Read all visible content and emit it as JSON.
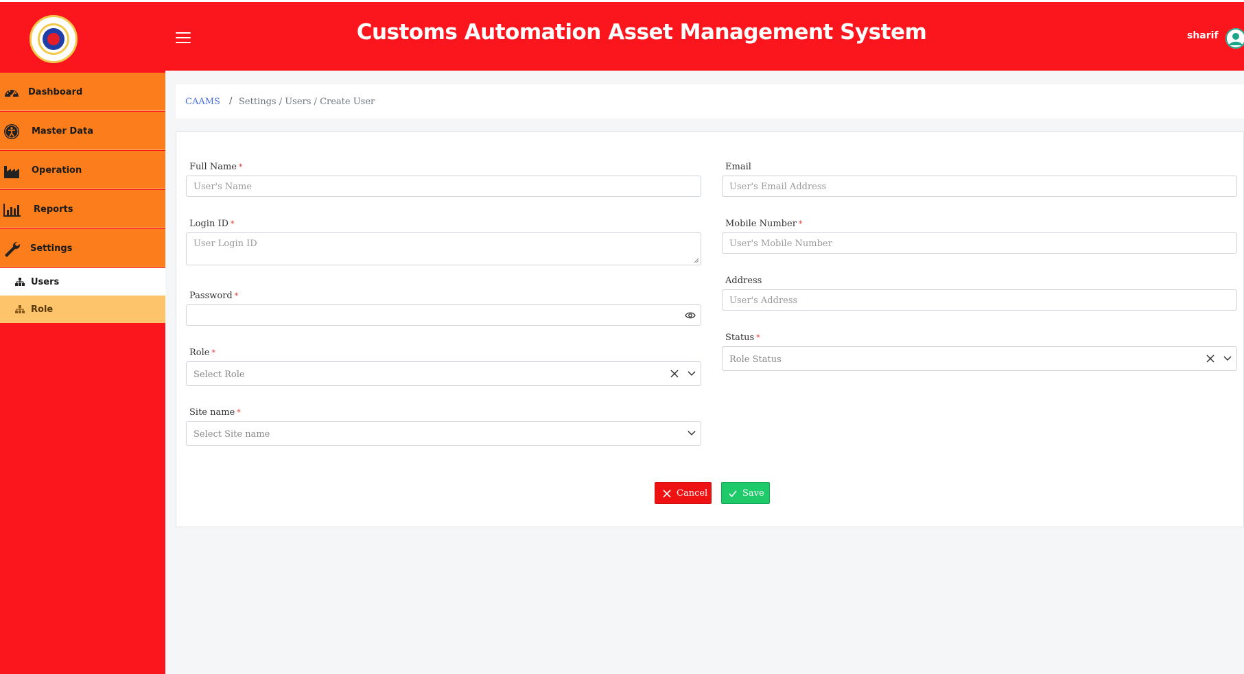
{
  "header": {
    "title": "Customs Automation Asset Management System",
    "username": "sharif",
    "logo_icon": "customs-emblem-logo",
    "menu_icon": "hamburger-menu-icon",
    "avatar_icon": "user-avatar-icon"
  },
  "sidebar": {
    "items": [
      {
        "label": "Dashboard",
        "icon": "dashboard-gauge-icon"
      },
      {
        "label": "Master Data",
        "icon": "accessibility-icon"
      },
      {
        "label": "Operation",
        "icon": "factory-icon"
      },
      {
        "label": "Reports",
        "icon": "bar-chart-icon"
      },
      {
        "label": "Settings",
        "icon": "wrench-icon"
      }
    ],
    "sub_items": [
      {
        "label": "Users",
        "icon": "sitemap-icon",
        "active": true
      },
      {
        "label": "Role",
        "icon": "sitemap-icon",
        "active": false
      }
    ]
  },
  "breadcrumb": {
    "home": "CAAMS",
    "separator": "/",
    "rest": "Settings / Users / Create User"
  },
  "form": {
    "full_name": {
      "label": "Full Name",
      "placeholder": "User's Name",
      "required": "*"
    },
    "email": {
      "label": "Email",
      "placeholder": "User's Email Address"
    },
    "login_id": {
      "label": "Login ID",
      "placeholder": "User Login ID",
      "required": "*"
    },
    "mobile": {
      "label": "Mobile Number",
      "placeholder": "User's Mobile Number",
      "required": "*"
    },
    "address": {
      "label": "Address",
      "placeholder": "User's Address"
    },
    "password": {
      "label": "Password",
      "placeholder": "",
      "required": "*"
    },
    "role": {
      "label": "Role",
      "placeholder": "Select Role",
      "required": "*"
    },
    "status": {
      "label": "Status",
      "placeholder": "Role Status",
      "required": "*"
    },
    "site_name": {
      "label": "Site name",
      "placeholder": "Select Site name",
      "required": "*"
    }
  },
  "buttons": {
    "cancel": "Cancel",
    "save": "Save"
  },
  "colors": {
    "header_red": "#fb151d",
    "sidebar_orange": "#fb7d1c",
    "sub_active_bg": "#ffffff",
    "sub_hover_bg": "#fdc46c",
    "cancel_red": "#ee1212",
    "save_green": "#1fca6b",
    "link_blue": "#4a6fd8"
  }
}
